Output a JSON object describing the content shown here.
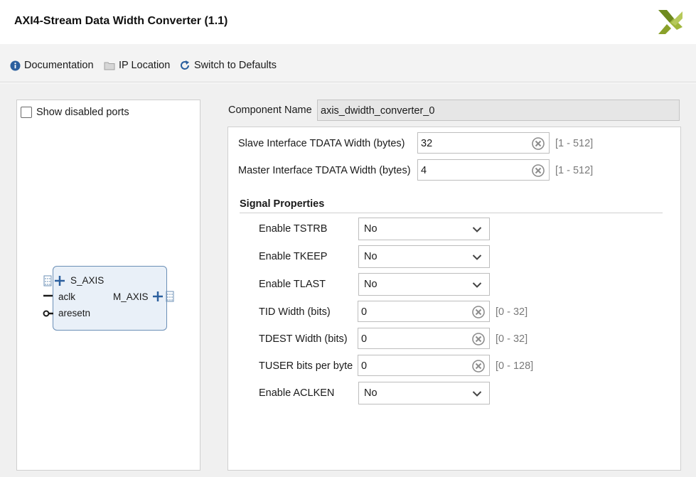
{
  "window": {
    "title": "AXI4-Stream Data Width Converter (1.1)"
  },
  "toolbar": {
    "documentation": "Documentation",
    "ip_location": "IP Location",
    "switch_defaults": "Switch to Defaults"
  },
  "left_panel": {
    "show_disabled_ports": "Show disabled ports",
    "block": {
      "s_axis": "S_AXIS",
      "aclk": "aclk",
      "aresetn": "aresetn",
      "m_axis": "M_AXIS"
    }
  },
  "component": {
    "label": "Component Name",
    "value": "axis_dwidth_converter_0"
  },
  "widths": {
    "slave": {
      "label": "Slave Interface TDATA Width (bytes)",
      "value": "32",
      "range": "[1 - 512]"
    },
    "master": {
      "label": "Master Interface TDATA Width (bytes)",
      "value": "4",
      "range": "[1 - 512]"
    }
  },
  "signal_properties": {
    "title": "Signal Properties",
    "tstrb": {
      "label": "Enable TSTRB",
      "value": "No"
    },
    "tkeep": {
      "label": "Enable TKEEP",
      "value": "No"
    },
    "tlast": {
      "label": "Enable TLAST",
      "value": "No"
    },
    "tid": {
      "label": "TID Width (bits)",
      "value": "0",
      "range": "[0 - 32]"
    },
    "tdest": {
      "label": "TDEST Width (bits)",
      "value": "0",
      "range": "[0 - 32]"
    },
    "tuser": {
      "label": "TUSER bits per byte",
      "value": "0",
      "range": "[0 - 128]"
    },
    "aclken": {
      "label": "Enable ACLKEN",
      "value": "No"
    }
  },
  "icons": {
    "documentation": "info-icon",
    "ip_location": "folder-icon",
    "switch_defaults": "refresh-icon",
    "clear": "clear-icon",
    "dropdown": "chevron-down-icon",
    "logo": "xilinx-logo-icon"
  },
  "colors": {
    "logo": "#8aa12a",
    "block_fill": "#e9f0f8",
    "block_border": "#6b8fb6",
    "info": "#2b5f9e"
  }
}
